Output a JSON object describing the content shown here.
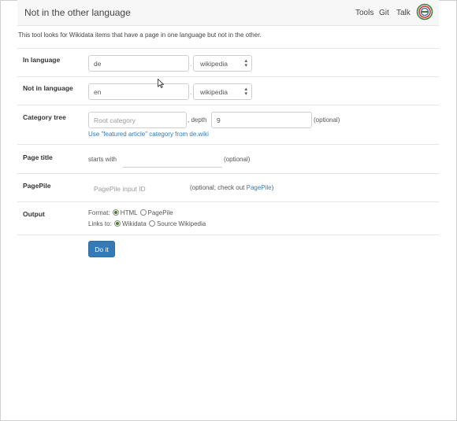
{
  "header": {
    "title": "Not in the other language",
    "nav": [
      "Tools",
      "Git",
      "Talk"
    ]
  },
  "intro": "This tool looks for Wikidata items that have a page in one language but not in the other.",
  "form": {
    "in_language": {
      "label": "In language",
      "value": "de",
      "project": "wikipedia"
    },
    "not_in_language": {
      "label": "Not in language",
      "value": "en",
      "project": "wikipedia"
    },
    "category_tree": {
      "label": "Category tree",
      "placeholder": "Root category",
      "depth_label": ", depth",
      "depth_value": "9",
      "optional": "(optional)",
      "featured_link": "Use \"featured article\" category from de.wiki"
    },
    "page_title": {
      "label": "Page title",
      "prefix": "starts with",
      "optional": "(optional)"
    },
    "pagepile": {
      "label": "PagePile",
      "placeholder": "PagePile input ID",
      "note": "(optional; check out ",
      "link": "PagePile",
      "note_end": ")"
    },
    "output": {
      "label": "Output",
      "format_label": "Format:",
      "format_options": [
        "HTML",
        "PagePile"
      ],
      "format_selected": "HTML",
      "links_label": "Links to:",
      "links_options": [
        "Wikidata",
        "Source Wikipedia"
      ],
      "links_selected": "Wikidata"
    },
    "submit_label": "Do it"
  },
  "colors": {
    "primary": "#337ab7",
    "navbar": "#f7f7f7"
  }
}
